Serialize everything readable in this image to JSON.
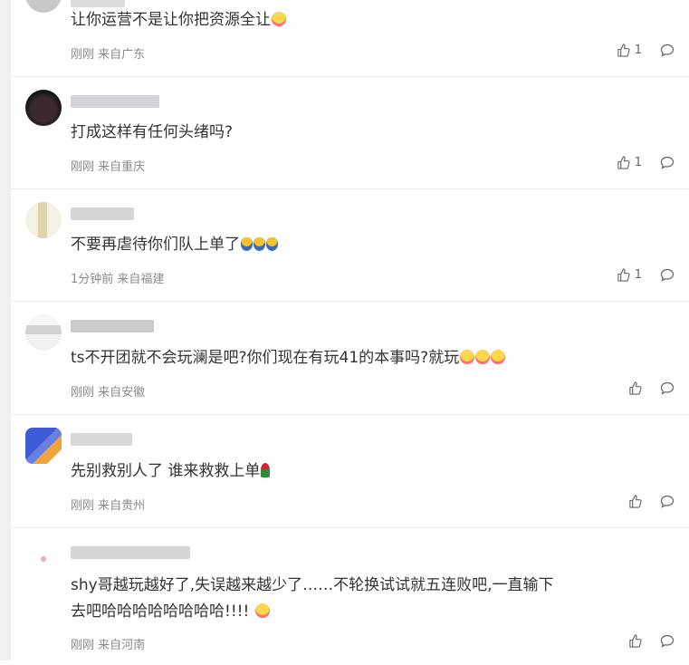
{
  "comments": [
    {
      "text_line1": "让你运营不是让你把资源全让",
      "text_line2": "",
      "emojis": [
        "shy-emoji"
      ],
      "time": "刚刚",
      "location": "来自广东",
      "likes": "1",
      "avatar_color": "#bfbfbf",
      "nick_color": "#d9d9d9"
    },
    {
      "text_line1": "打成这样有任何头绪吗?",
      "text_line2": "",
      "emojis": [],
      "time": "刚刚",
      "location": "来自重庆",
      "likes": "1",
      "avatar_color": "#1e1a1c",
      "nick_color": "#d2d2d6"
    },
    {
      "text_line1": "不要再虐待你们队上单了",
      "text_line2": "",
      "emojis": [
        "sweat-emoji",
        "sweat-emoji",
        "sweat-emoji"
      ],
      "time": "1分钟前",
      "location": "来自福建",
      "likes": "1",
      "avatar_color": "#e8e2c9",
      "nick_color": "#d6d6d6"
    },
    {
      "text_line1": "ts不开团就不会玩澜是吧?你们现在有玩41的本事吗?就玩",
      "text_line2": "",
      "emojis": [
        "shy-emoji",
        "shy-emoji",
        "shy-emoji"
      ],
      "time": "刚刚",
      "location": "来自安徽",
      "likes": "",
      "avatar_color": "#d4d4d4",
      "nick_color": "#c9c9c9"
    },
    {
      "text_line1": "先别救别人了 谁来救救上单",
      "text_line2": "",
      "emojis": [
        "rose-emoji"
      ],
      "time": "刚刚",
      "location": "来自贵州",
      "likes": "",
      "avatar_color": "#3a57c9",
      "nick_color": "#d8d8d8"
    },
    {
      "text_line1": "shy哥越玩越好了,失误越来越少了……不轮换试试就五连败吧,一直输下",
      "text_line2": "去吧哈哈哈哈哈哈哈哈!!!!",
      "emojis": [
        "shy-emoji"
      ],
      "time": "刚刚",
      "location": "来自河南",
      "likes": "",
      "avatar_color": "#f3e3e3",
      "nick_color": "#d6d6d6"
    }
  ],
  "icons": {
    "like": "thumbs-up-icon",
    "reply": "comment-bubble-icon"
  }
}
